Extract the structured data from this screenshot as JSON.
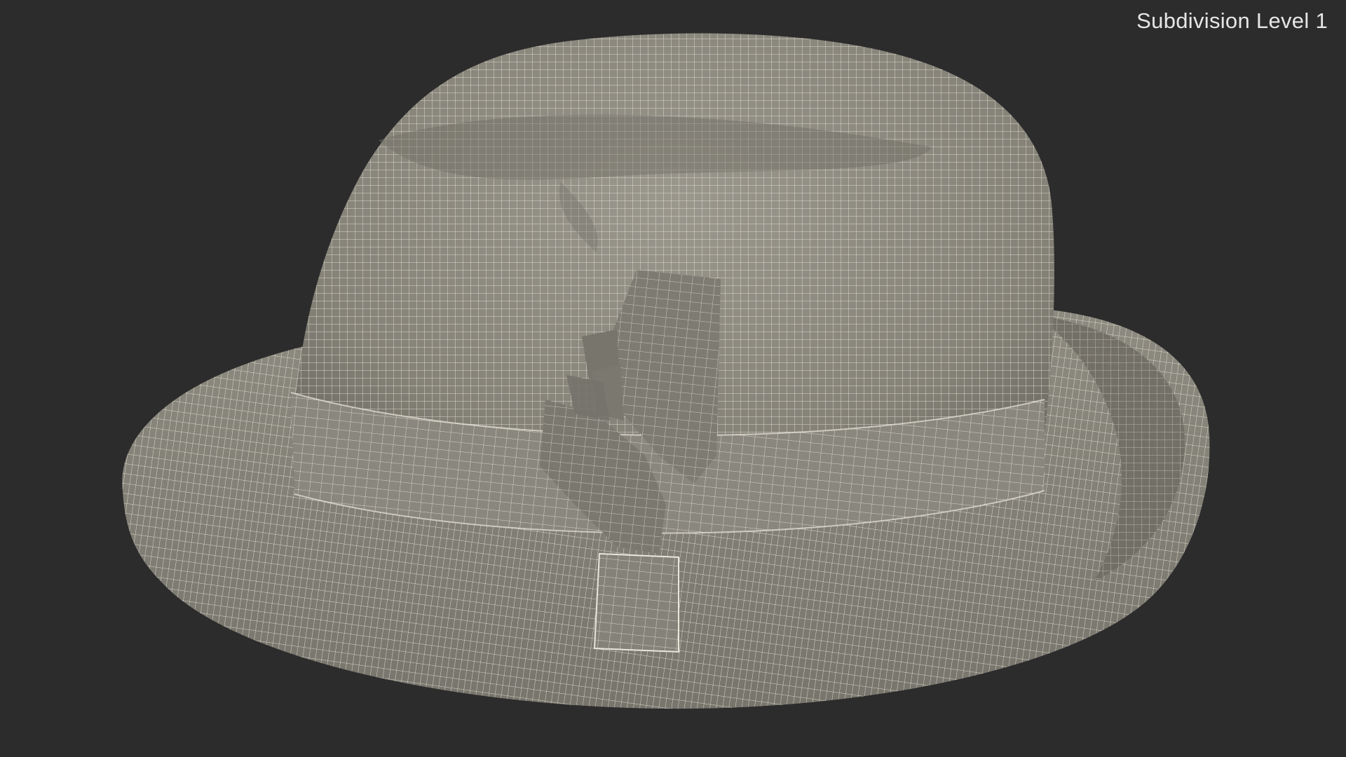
{
  "viewport": {
    "label": "Subdivision Level 1",
    "background_color": "#2c2c2c",
    "label_color": "#e6e6e6"
  },
  "model": {
    "subject": "fedora-hat",
    "surface_color": "#8f8c82",
    "wire_color": "#e9e6da",
    "feather_color": "#7d7b72"
  }
}
